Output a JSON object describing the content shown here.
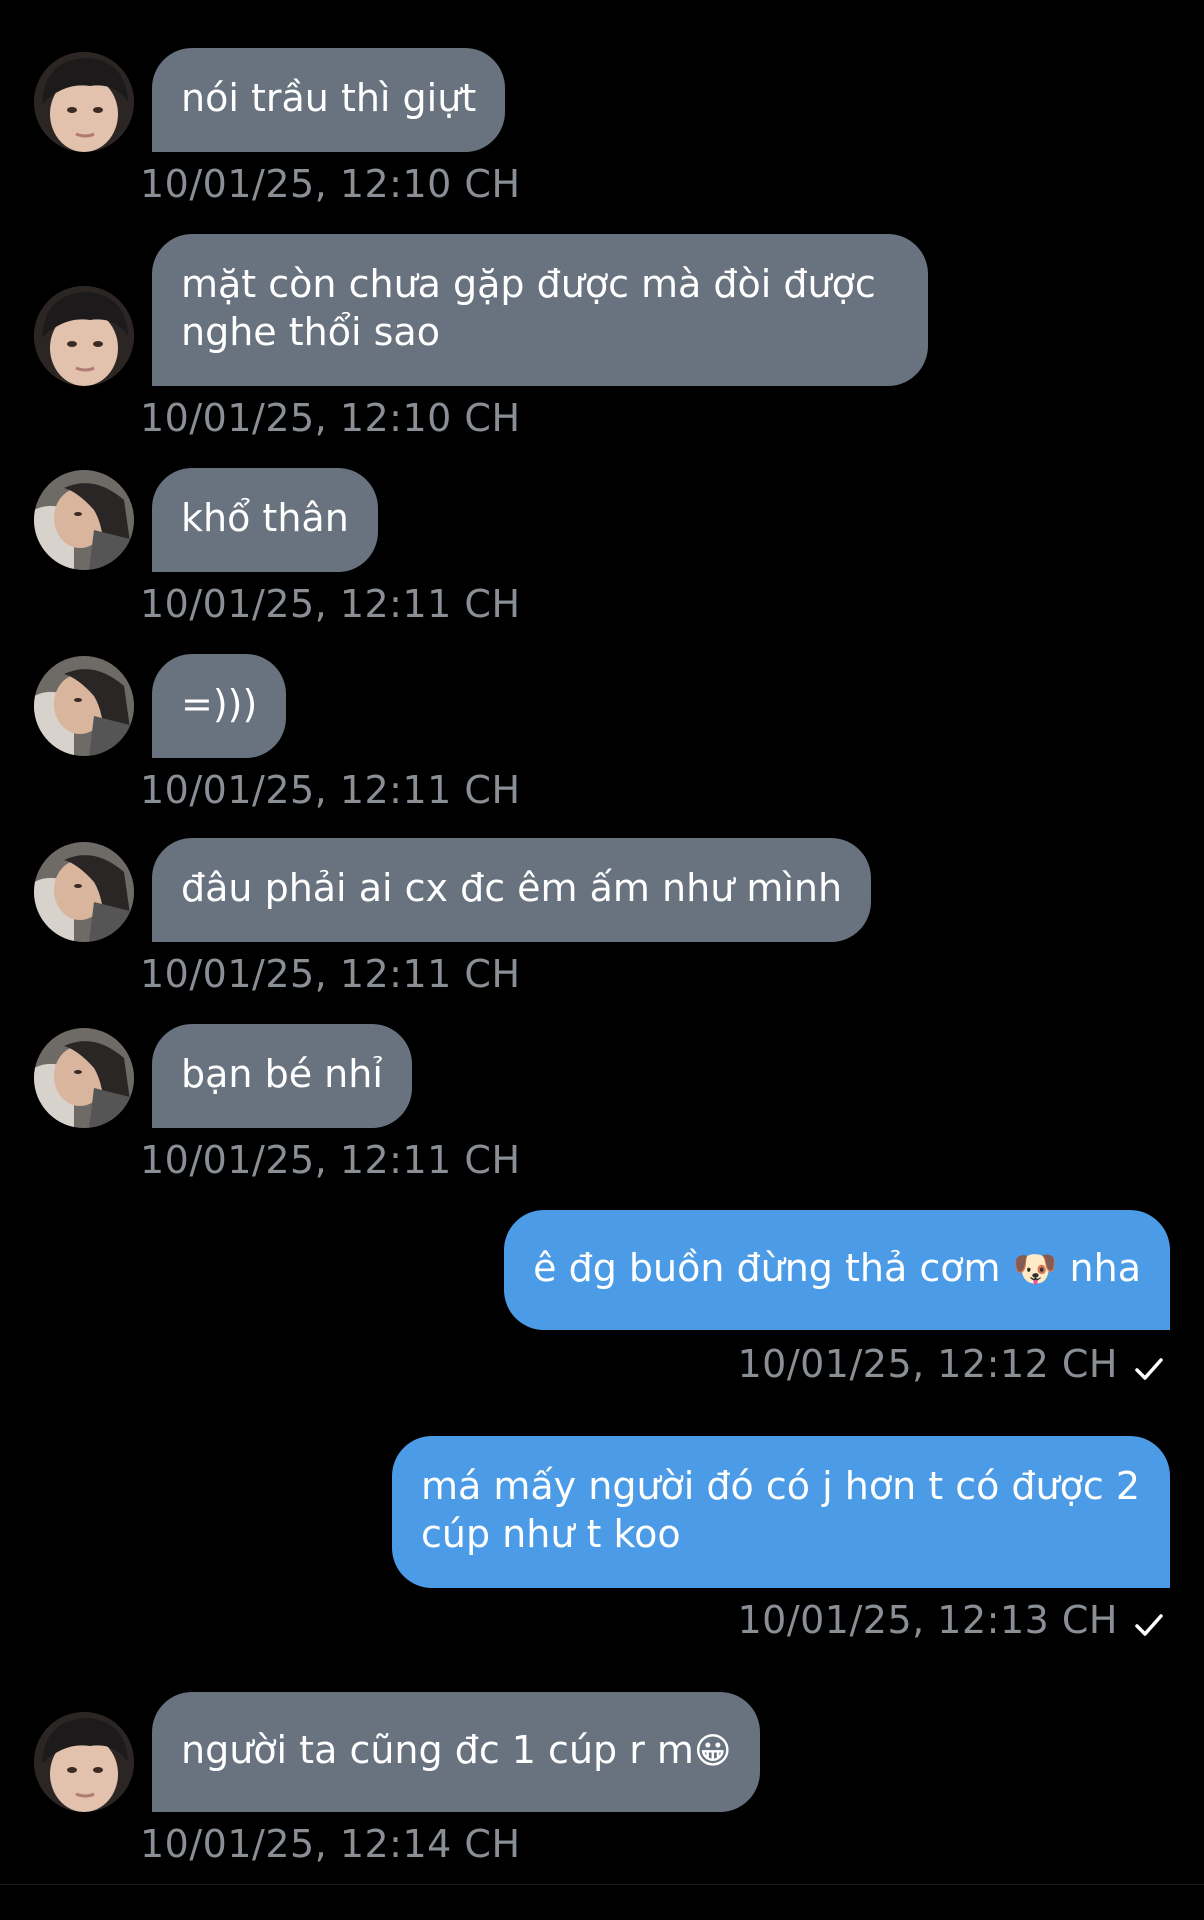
{
  "messages": [
    {
      "text": "nói trầu thì giựt",
      "time": "10/01/25, 12:10 CH",
      "sender": "boy"
    },
    {
      "text": "mặt còn chưa gặp được mà đòi được nghe thổi sao",
      "time": "10/01/25, 12:10 CH",
      "sender": "boy"
    },
    {
      "text": "khổ thân",
      "time": "10/01/25, 12:11 CH",
      "sender": "girl"
    },
    {
      "text": "=)))",
      "time": "10/01/25, 12:11 CH",
      "sender": "girl"
    },
    {
      "text": "đâu phải ai cx đc êm ấm như mình",
      "time": "10/01/25, 12:11 CH",
      "sender": "girl"
    },
    {
      "text": "bạn bé nhỉ",
      "time": "10/01/25, 12:11 CH",
      "sender": "girl"
    },
    {
      "text_a": "ê đg buồn đừng thả cơm",
      "emoji": "🐶",
      "text_b": "nha",
      "time": "10/01/25, 12:12 CH",
      "sender": "me"
    },
    {
      "text": "má mấy người đó có j hơn t có được 2 cúp như t koo",
      "time": "10/01/25, 12:13 CH",
      "sender": "me"
    },
    {
      "text": "người ta cũng đc 1 cúp r m",
      "emoji": "😀",
      "time": "10/01/25, 12:14 CH",
      "sender": "boy"
    }
  ],
  "colors": {
    "incoming_bubble": "#68737f",
    "outgoing_bubble": "#4c9be7",
    "timestamp": "#8a8f95",
    "background": "#000000"
  },
  "icons": {
    "read_receipt": "checkmark-icon"
  }
}
